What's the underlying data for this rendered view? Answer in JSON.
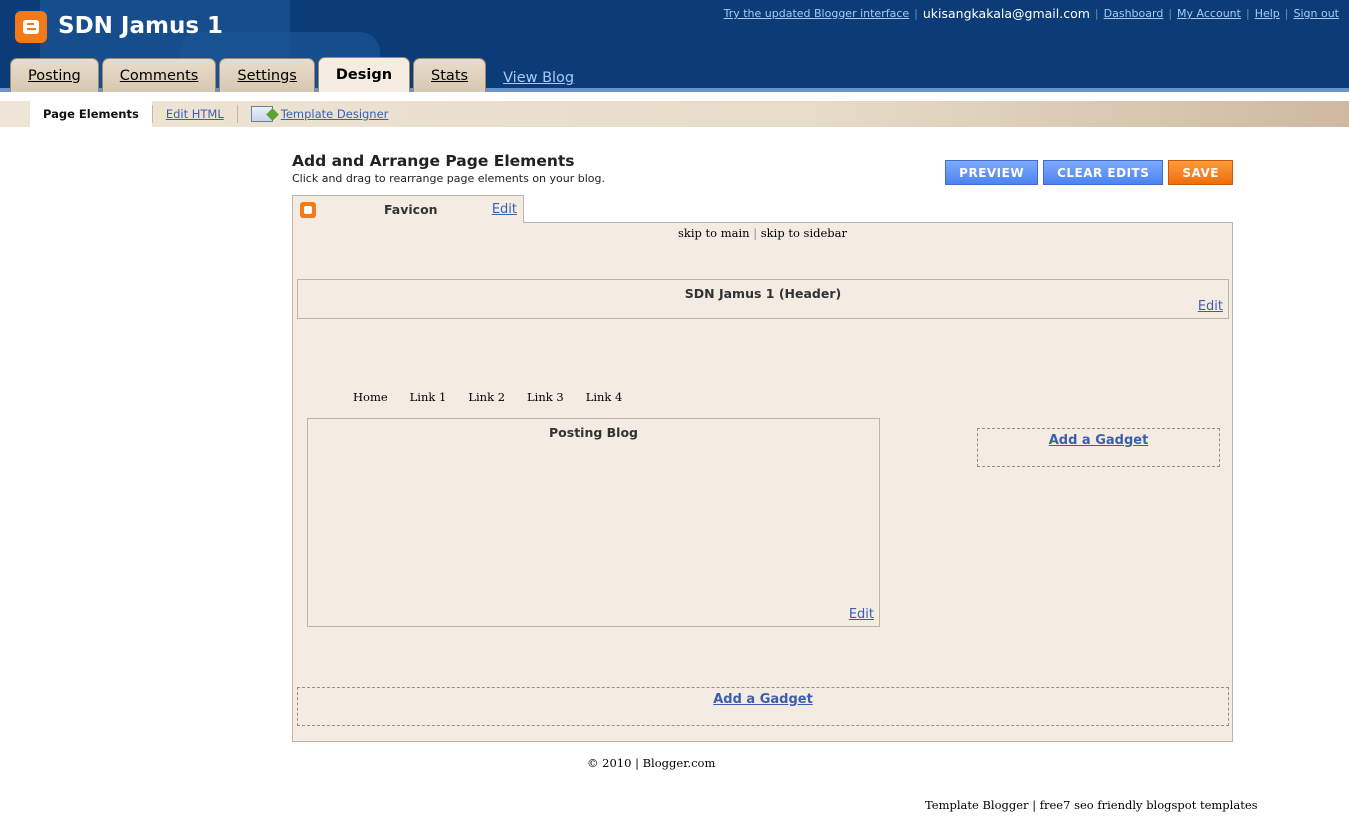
{
  "header": {
    "blog_title": "SDN Jamus 1",
    "links": {
      "try_updated": "Try the updated Blogger interface",
      "email": "ukisangkakala@gmail.com",
      "dashboard": "Dashboard",
      "my_account": "My Account",
      "help": "Help",
      "sign_out": "Sign out"
    },
    "tabs": [
      {
        "label": "Posting"
      },
      {
        "label": "Comments"
      },
      {
        "label": "Settings"
      },
      {
        "label": "Design"
      },
      {
        "label": "Stats"
      }
    ],
    "active_tab": "Design",
    "view_blog": "View Blog"
  },
  "subnav": {
    "page_elements": "Page Elements",
    "edit_html": "Edit HTML",
    "template_designer": "Template Designer"
  },
  "content": {
    "title": "Add and Arrange Page Elements",
    "subtitle": "Click and drag to rearrange page elements on your blog.",
    "buttons": {
      "preview": "PREVIEW",
      "clear_edits": "CLEAR EDITS",
      "save": "SAVE"
    }
  },
  "favicon": {
    "label": "Favicon",
    "edit": "Edit"
  },
  "layout": {
    "skip_main": "skip to main",
    "skip_sep": "|",
    "skip_sidebar": "skip to sidebar",
    "header_widget": {
      "title": "SDN Jamus 1 (Header)",
      "edit": "Edit"
    },
    "nav_links": [
      "Home",
      "Link 1",
      "Link 2",
      "Link 3",
      "Link 4"
    ],
    "posting_widget": {
      "title": "Posting Blog",
      "edit": "Edit"
    },
    "sidebar_gadget": "Add a Gadget",
    "bottom_gadget": "Add a Gadget"
  },
  "footer": {
    "copyright": "© 2010 | Blogger.com",
    "template_credit": "Template Blogger | free7 seo friendly blogspot templates"
  },
  "colors": {
    "header_bg": "#0b3c78",
    "accent_orange": "#f47a17",
    "button_blue": "#4d83f0",
    "canvas_bg": "#f4ebe2"
  }
}
